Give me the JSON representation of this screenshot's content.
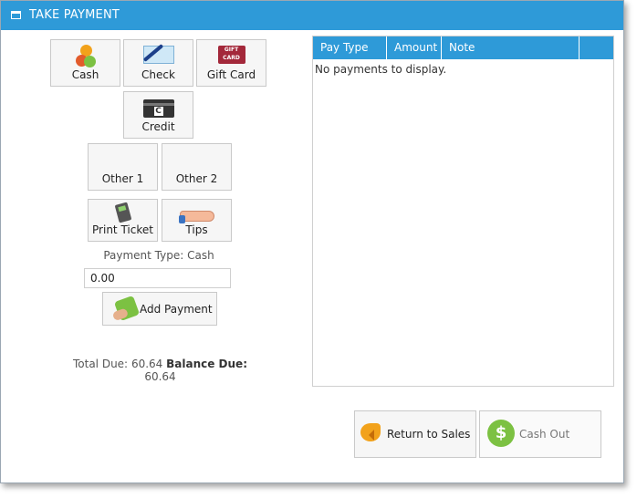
{
  "window": {
    "title": "TAKE PAYMENT"
  },
  "payment_methods": {
    "cash": {
      "label": "Cash",
      "icon": "coins-icon"
    },
    "check": {
      "label": "Check",
      "icon": "check-icon"
    },
    "gift_card": {
      "label": "Gift Card",
      "icon": "gift-card-icon",
      "icon_text": "GIFT CARD"
    },
    "credit": {
      "label": "Credit",
      "icon": "credit-card-icon",
      "icon_text": "C"
    },
    "other1": {
      "label": "Other 1"
    },
    "other2": {
      "label": "Other 2"
    },
    "print_ticket": {
      "label": "Print Ticket",
      "icon": "card-terminal-icon"
    },
    "tips": {
      "label": "Tips",
      "icon": "tip-hand-icon"
    }
  },
  "payment_type_text": "Payment Type: Cash",
  "amount_input": {
    "value": "0.00"
  },
  "add_payment": {
    "label": "Add Payment",
    "icon": "add-payment-icon"
  },
  "totals": {
    "total_due_label": "Total Due:",
    "total_due_value": "60.64",
    "balance_due_label": "Balance Due:",
    "balance_due_value": "60.64"
  },
  "payments_table": {
    "columns": [
      "Pay Type",
      "Amount",
      "Note",
      ""
    ],
    "empty_text": "No payments to display."
  },
  "footer_buttons": {
    "return_to_sales": {
      "label": "Return to Sales",
      "icon": "return-arrow-icon"
    },
    "cash_out": {
      "label": "Cash Out",
      "icon": "dollar-coin-icon",
      "icon_text": "$"
    }
  },
  "colors": {
    "accent": "#2e9ad8",
    "cash_green": "#7cc142",
    "return_orange": "#f2a21b"
  }
}
